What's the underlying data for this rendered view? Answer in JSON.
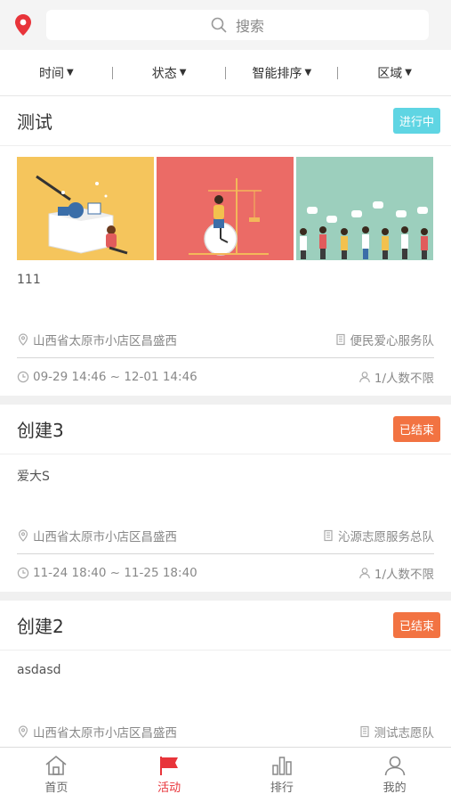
{
  "header": {
    "location_icon": "location-pin-icon",
    "search_placeholder": "搜索",
    "search_icon": "search-icon"
  },
  "filters": [
    {
      "label": "时间"
    },
    {
      "label": "状态"
    },
    {
      "label": "智能排序"
    },
    {
      "label": "区域"
    }
  ],
  "activities": [
    {
      "title": "测试",
      "status": "进行中",
      "status_color": "#5fd5e3",
      "description": "111",
      "location": "山西省太原市小店区昌盛西",
      "team": "便民爱心服务队",
      "time": "09-29 14:46 ~ 12-01 14:46",
      "capacity": "1/人数不限",
      "image_names": [
        "box-illustration",
        "clock-crane-illustration",
        "people-chat-illustration"
      ]
    },
    {
      "title": "创建3",
      "status": "已结束",
      "status_color": "#f27342",
      "description": "爱大S",
      "location": "山西省太原市小店区昌盛西",
      "team": "沁源志愿服务总队",
      "time": "11-24 18:40 ~ 11-25 18:40",
      "capacity": "1/人数不限"
    },
    {
      "title": "创建2",
      "status": "已结束",
      "status_color": "#f27342",
      "description": "asdasd",
      "location": "山西省太原市小店区昌盛西",
      "team": "测试志愿队"
    }
  ],
  "tabbar": [
    {
      "label": "首页",
      "icon": "home-icon",
      "active": false
    },
    {
      "label": "活动",
      "icon": "flag-icon",
      "active": true
    },
    {
      "label": "排行",
      "icon": "bar-chart-icon",
      "active": false
    },
    {
      "label": "我的",
      "icon": "user-icon",
      "active": false
    }
  ],
  "colors": {
    "accent": "#e8343a",
    "running": "#5fd5e3",
    "ended": "#f27342"
  }
}
